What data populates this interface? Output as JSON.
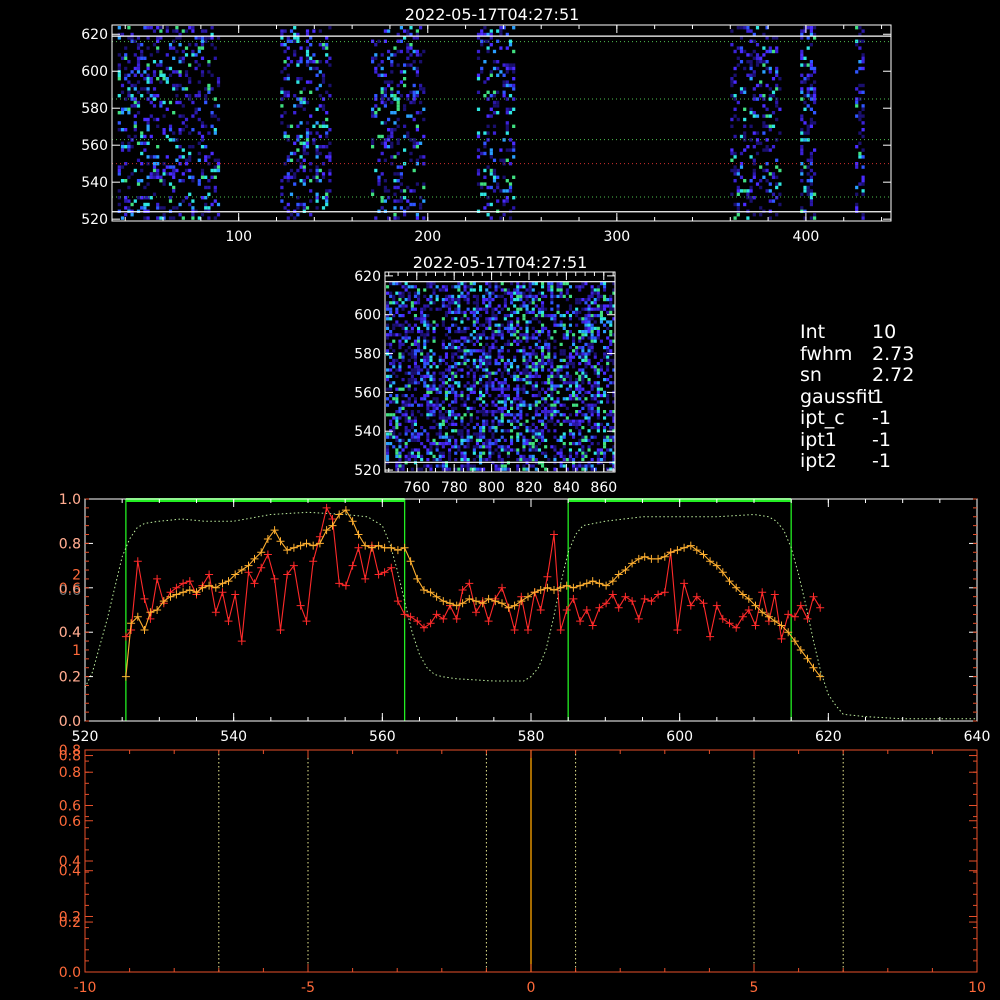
{
  "colors": {
    "background": "#000000",
    "axes": "#ffffff",
    "frame_lower": "#e8502a",
    "ylabels_lower": "#ff6a3a",
    "profile_red": "#ff2a2a",
    "profile_orange": "#ffb030",
    "dotted_green": "#bff0a0",
    "region_green": "#22ee22",
    "center_line": "#ffa500",
    "dotted_lower": "#e8e890",
    "guide_green": "#50c050",
    "guide_red": "#d03030"
  },
  "chart_data": [
    {
      "type": "heatmap",
      "title": "2022-05-17T04:27:51",
      "xlim": [
        33,
        445
      ],
      "ylim": [
        519,
        625
      ],
      "xticks": [
        100,
        200,
        300,
        400
      ],
      "yticks": [
        520,
        540,
        560,
        580,
        600,
        620
      ],
      "bright_bands_x": [
        [
          36,
          90
        ],
        [
          122,
          148
        ],
        [
          170,
          198
        ],
        [
          226,
          246
        ],
        [
          360,
          386
        ],
        [
          397,
          405
        ],
        [
          426,
          430
        ]
      ],
      "solid_lines_y": [
        524,
        619
      ],
      "dotted_green_y": [
        532,
        563,
        585,
        616
      ],
      "dotted_red_y": [
        550
      ]
    },
    {
      "type": "heatmap",
      "title": "2022-05-17T04:27:51",
      "xlim": [
        743,
        866
      ],
      "ylim": [
        519,
        622
      ],
      "xticks": [
        760,
        780,
        800,
        820,
        840,
        860
      ],
      "yticks": [
        520,
        540,
        560,
        580,
        600,
        620
      ],
      "solid_lines_y": [
        524,
        617
      ]
    },
    {
      "type": "line",
      "xlim": [
        520,
        640
      ],
      "ylim": [
        0,
        1.0
      ],
      "xticks": [
        520,
        540,
        560,
        580,
        600,
        620,
        640
      ],
      "yticks_left": [
        "0.0",
        "0.2",
        "0.4",
        "0.6",
        "0.8",
        "1.0"
      ],
      "yticks_left_positions": [
        0,
        0.2,
        0.4,
        0.6,
        0.8,
        1.0
      ],
      "yticks_extra": [
        "1",
        "2"
      ],
      "yticks_extra_positions": [
        0.32,
        0.66
      ],
      "dup_ticks": [
        "0.0",
        "0.2",
        "0.4",
        "0.6",
        "0.8",
        "1.0"
      ],
      "dup_ticks_positions": [
        0.0,
        0.2,
        0.4,
        0.59,
        0.8,
        1.0
      ],
      "regions": [
        [
          525.5,
          563
        ],
        [
          585,
          615
        ]
      ],
      "series": [
        {
          "values_x": [
            525.5,
            526.2,
            527.1,
            528.0,
            528.8,
            529.7,
            530.6,
            531.5,
            532.3,
            533.2,
            534.1,
            535.0,
            535.8,
            536.7,
            537.6,
            538.5,
            539.3,
            540.2,
            541.1,
            542.0,
            542.8,
            543.7,
            544.6,
            545.5,
            546.3,
            547.2,
            548.1,
            549.0,
            549.8,
            550.7,
            551.6,
            552.5,
            553.3,
            554.2,
            555.1,
            556.0,
            556.8,
            557.7,
            558.6,
            559.5,
            560.3,
            561.2,
            562.1,
            563.0,
            563.8,
            564.7,
            565.6,
            566.5,
            567.3,
            568.2,
            569.1,
            570.0,
            570.8,
            571.7,
            572.6,
            573.5,
            574.3,
            575.2,
            576.1,
            577.0,
            577.8,
            578.7,
            579.6,
            580.5,
            581.3,
            582.2,
            583.1,
            584.0,
            584.8,
            585.7,
            586.6,
            587.5,
            588.3,
            589.2,
            590.1,
            591.0,
            591.8,
            592.7,
            593.6,
            594.5,
            595.3,
            596.2,
            597.1,
            598.0,
            598.8,
            599.7,
            600.6,
            601.5,
            602.3,
            603.2,
            604.1,
            605.0,
            605.8,
            606.7,
            607.6,
            608.5,
            609.3,
            610.2,
            611.1,
            612.0,
            612.8,
            613.7,
            614.6,
            615.5,
            616.3,
            617.2,
            618.0,
            618.9
          ],
          "values": [
            0.38,
            0.41,
            0.72,
            0.55,
            0.46,
            0.64,
            0.53,
            0.58,
            0.6,
            0.62,
            0.63,
            0.57,
            0.61,
            0.66,
            0.49,
            0.58,
            0.45,
            0.57,
            0.36,
            0.67,
            0.62,
            0.69,
            0.75,
            0.64,
            0.41,
            0.66,
            0.7,
            0.52,
            0.45,
            0.72,
            0.83,
            0.96,
            0.91,
            0.62,
            0.61,
            0.7,
            0.78,
            0.64,
            0.79,
            0.66,
            0.67,
            0.69,
            0.54,
            0.48,
            0.47,
            0.45,
            0.42,
            0.44,
            0.48,
            0.46,
            0.52,
            0.46,
            0.59,
            0.62,
            0.49,
            0.54,
            0.45,
            0.55,
            0.6,
            0.51,
            0.41,
            0.56,
            0.41,
            0.58,
            0.5,
            0.65,
            0.84,
            0.41,
            0.5,
            0.55,
            0.45,
            0.5,
            0.43,
            0.51,
            0.53,
            0.57,
            0.51,
            0.56,
            0.54,
            0.46,
            0.55,
            0.54,
            0.57,
            0.58,
            0.76,
            0.41,
            0.62,
            0.52,
            0.56,
            0.53,
            0.38,
            0.52,
            0.46,
            0.44,
            0.42,
            0.47,
            0.5,
            0.43,
            0.58,
            0.45,
            0.57,
            0.37,
            0.48,
            0.47,
            0.52,
            0.46,
            0.56,
            0.51
          ]
        },
        {
          "values_x": [
            525.5,
            526.2,
            527.1,
            528.0,
            528.8,
            529.7,
            530.6,
            531.5,
            532.3,
            533.2,
            534.1,
            535.0,
            535.8,
            536.7,
            537.6,
            538.5,
            539.3,
            540.2,
            541.1,
            542.0,
            542.8,
            543.7,
            544.6,
            545.5,
            546.3,
            547.2,
            548.1,
            549.0,
            549.8,
            550.7,
            551.6,
            552.5,
            553.3,
            554.2,
            555.1,
            556.0,
            556.8,
            557.7,
            558.6,
            559.5,
            560.3,
            561.2,
            562.1,
            563.0,
            563.8,
            564.7,
            565.6,
            566.5,
            567.3,
            568.2,
            569.1,
            570.0,
            570.8,
            571.7,
            572.6,
            573.5,
            574.3,
            575.2,
            576.1,
            577.0,
            577.8,
            578.7,
            579.6,
            580.5,
            581.3,
            582.2,
            583.1,
            584.0,
            584.8,
            585.7,
            586.6,
            587.5,
            588.3,
            589.2,
            590.1,
            591.0,
            591.8,
            592.7,
            593.6,
            594.5,
            595.3,
            596.2,
            597.1,
            598.0,
            598.8,
            599.7,
            600.6,
            601.5,
            602.3,
            603.2,
            604.1,
            605.0,
            605.8,
            606.7,
            607.6,
            608.5,
            609.3,
            610.2,
            611.1,
            612.0,
            612.8,
            613.7,
            614.6,
            615.5,
            616.3,
            617.2,
            618.0,
            618.9
          ],
          "values": [
            0.2,
            0.44,
            0.47,
            0.41,
            0.49,
            0.5,
            0.54,
            0.56,
            0.57,
            0.58,
            0.59,
            0.58,
            0.6,
            0.61,
            0.6,
            0.62,
            0.63,
            0.66,
            0.68,
            0.7,
            0.73,
            0.76,
            0.82,
            0.86,
            0.81,
            0.77,
            0.78,
            0.79,
            0.8,
            0.79,
            0.8,
            0.86,
            0.88,
            0.93,
            0.95,
            0.9,
            0.84,
            0.79,
            0.78,
            0.79,
            0.78,
            0.78,
            0.77,
            0.78,
            0.72,
            0.64,
            0.59,
            0.58,
            0.56,
            0.54,
            0.53,
            0.52,
            0.53,
            0.55,
            0.54,
            0.53,
            0.55,
            0.54,
            0.53,
            0.51,
            0.52,
            0.54,
            0.56,
            0.58,
            0.59,
            0.6,
            0.59,
            0.6,
            0.61,
            0.6,
            0.61,
            0.62,
            0.63,
            0.62,
            0.61,
            0.63,
            0.66,
            0.68,
            0.71,
            0.73,
            0.74,
            0.73,
            0.73,
            0.74,
            0.76,
            0.77,
            0.78,
            0.79,
            0.77,
            0.75,
            0.72,
            0.7,
            0.67,
            0.63,
            0.6,
            0.57,
            0.55,
            0.52,
            0.49,
            0.47,
            0.45,
            0.43,
            0.4,
            0.36,
            0.32,
            0.28,
            0.24,
            0.2
          ]
        },
        {
          "values_x": [
            520,
            521,
            522,
            523,
            524,
            525,
            526,
            527,
            528,
            530,
            533,
            536,
            540,
            545,
            550,
            555,
            558,
            560,
            561,
            562,
            563,
            564,
            565,
            566,
            567,
            568,
            570,
            575,
            579,
            580,
            581,
            582,
            583,
            584,
            585,
            586,
            587,
            590,
            595,
            600,
            605,
            610,
            612,
            613,
            614,
            615,
            616,
            617,
            618,
            619,
            620,
            621,
            622,
            625,
            630,
            635,
            640
          ],
          "values": [
            0.15,
            0.22,
            0.34,
            0.46,
            0.6,
            0.74,
            0.82,
            0.87,
            0.89,
            0.9,
            0.91,
            0.9,
            0.9,
            0.93,
            0.94,
            0.93,
            0.92,
            0.88,
            0.8,
            0.68,
            0.54,
            0.4,
            0.3,
            0.24,
            0.21,
            0.2,
            0.19,
            0.18,
            0.18,
            0.2,
            0.24,
            0.32,
            0.46,
            0.62,
            0.76,
            0.84,
            0.88,
            0.9,
            0.92,
            0.92,
            0.92,
            0.93,
            0.92,
            0.9,
            0.86,
            0.78,
            0.66,
            0.52,
            0.36,
            0.22,
            0.12,
            0.07,
            0.03,
            0.02,
            0.01,
            0.01,
            0.01
          ]
        }
      ]
    },
    {
      "type": "line",
      "xlim": [
        -10,
        10
      ],
      "ylim": [
        0,
        0.8
      ],
      "xticks": [
        "-10",
        "-5",
        "0",
        "5",
        "10"
      ],
      "xticks_positions": [
        -10,
        -5,
        0,
        5,
        10
      ],
      "yticks_left": [
        "0.0",
        "0.2",
        "0.2",
        "0.4",
        "0.4",
        "0.6",
        "0.6",
        "0.8",
        "0.8",
        "0.8"
      ],
      "yticks_left_positions": [
        0,
        0.18,
        0.2,
        0.365,
        0.4,
        0.545,
        0.6,
        0.72,
        0.78,
        0.8
      ],
      "center_line_x": 0,
      "dotted_x": [
        -7,
        -5,
        -1,
        1,
        5,
        7
      ]
    }
  ],
  "info": {
    "rows": [
      {
        "k": "Int",
        "v": "10"
      },
      {
        "k": "fwhm",
        "v": "2.73"
      },
      {
        "k": "sn",
        "v": "2.72"
      },
      {
        "k": "gaussfit",
        "v": "1"
      },
      {
        "k": "ipt_c",
        "v": "-1"
      },
      {
        "k": "ipt1",
        "v": "-1"
      },
      {
        "k": "ipt2",
        "v": "-1"
      }
    ]
  }
}
